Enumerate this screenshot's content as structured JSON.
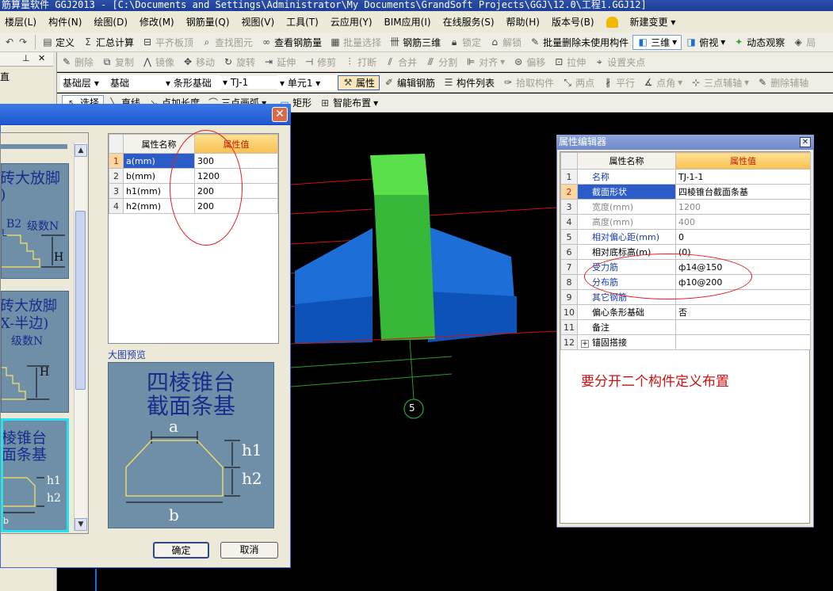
{
  "window": {
    "title": "筋算量软件 GGJ2013 - [C:\\Documents and Settings\\Administrator\\My Documents\\GrandSoft Projects\\GGJ\\12.0\\工程1.GGJ12]"
  },
  "menu": [
    "楼层(L)",
    "构件(N)",
    "绘图(D)",
    "修改(M)",
    "钢筋量(Q)",
    "视图(V)",
    "工具(T)",
    "云应用(Y)",
    "BIM应用(I)",
    "在线服务(S)",
    "帮助(H)",
    "版本号(B)",
    "新建变更 ▾"
  ],
  "toolbar1": {
    "define": "定义",
    "sum": "汇总计算",
    "align_top": "平齐板顶",
    "find": "查找图元",
    "view_rebar": "查看钢筋量",
    "batch_select": "批量选择",
    "rebar_3d": "钢筋三维",
    "lock": "锁定",
    "unlock": "解锁",
    "batch_delete": "批量删除未使用构件",
    "view3d": "三维",
    "topview": "俯视",
    "dynamic": "动态观察",
    "local": "局"
  },
  "toolbar2": [
    "删除",
    "复制",
    "镜像",
    "移动",
    "旋转",
    "延伸",
    "修剪",
    "打断",
    "合并",
    "分割",
    "对齐",
    "偏移",
    "拉伸",
    "设置夹点"
  ],
  "toolbar3": {
    "floor": "基础层",
    "category": "基础",
    "type": "条形基础",
    "component": "TJ-1",
    "unit": "单元1",
    "attribute": "属性",
    "edit_rebar": "编辑钢筋",
    "component_list": "构件列表",
    "pick": "拾取构件",
    "two_point": "两点",
    "parallel": "平行",
    "point_angle": "点角",
    "three_point": "三点辅轴",
    "delete_axis": "删除辅轴"
  },
  "toolbar4": {
    "select": "选择",
    "line": "直线",
    "point_length": "点加长度",
    "three_arc": "三点画弧",
    "rect": "矩形",
    "smart": "智能布置"
  },
  "left_panel": {
    "label": "直"
  },
  "dialog": {
    "shapes": [
      {
        "title": "砖大放脚\n)",
        "labels": [
          "B2",
          "级数N",
          "L",
          "H"
        ]
      },
      {
        "title": "砖大放脚\nX-半边)",
        "labels": [
          "级数N",
          "H"
        ]
      },
      {
        "title": "棱锥台\n面条基",
        "labels": [
          "h1",
          "h2",
          "b"
        ]
      }
    ],
    "table_headers": [
      "属性名称",
      "属性值"
    ],
    "params": [
      {
        "num": "1",
        "name": "a(mm)",
        "value": "300"
      },
      {
        "num": "2",
        "name": "b(mm)",
        "value": "1200"
      },
      {
        "num": "3",
        "name": "h1(mm)",
        "value": "200"
      },
      {
        "num": "4",
        "name": "h2(mm)",
        "value": "200"
      }
    ],
    "preview_label": "大图预览",
    "preview_title_1": "四棱锥台",
    "preview_title_2": "截面条基",
    "preview_dims": {
      "a": "a",
      "b": "b",
      "h1": "h1",
      "h2": "h2"
    },
    "ok": "确定",
    "cancel": "取消"
  },
  "viewport": {
    "axis_label": "5"
  },
  "prop_editor": {
    "title": "属性编辑器",
    "headers": [
      "属性名称",
      "属性值"
    ],
    "rows": [
      {
        "num": "1",
        "name": "名称",
        "value": "TJ-1-1",
        "style": "blue"
      },
      {
        "num": "2",
        "name": "截面形状",
        "value": "四棱锥台截面条基",
        "style": "selected"
      },
      {
        "num": "3",
        "name": "宽度(mm)",
        "value": "1200",
        "style": "gray"
      },
      {
        "num": "4",
        "name": "高度(mm)",
        "value": "400",
        "style": "gray"
      },
      {
        "num": "5",
        "name": "相对偏心距(mm)",
        "value": "0",
        "style": "blue"
      },
      {
        "num": "6",
        "name": "相对底标高(m)",
        "value": "(0)",
        "style": "normal"
      },
      {
        "num": "7",
        "name": "受力筋",
        "value": "ф14@150",
        "style": "blue"
      },
      {
        "num": "8",
        "name": "分布筋",
        "value": "ф10@200",
        "style": "blue"
      },
      {
        "num": "9",
        "name": "其它钢筋",
        "value": "",
        "style": "blue"
      },
      {
        "num": "10",
        "name": "偏心条形基础",
        "value": "否",
        "style": "normal"
      },
      {
        "num": "11",
        "name": "备注",
        "value": "",
        "style": "normal"
      },
      {
        "num": "12",
        "name": "锚固搭接",
        "value": "",
        "style": "expand"
      }
    ],
    "note": "要分开二个构件定义布置"
  },
  "colors": {
    "accent": "#2b4fa8",
    "annotation": "#e02020",
    "footing_blue": "#1e6ed8",
    "column_green": "#38b838",
    "rebar_red": "#d01010"
  }
}
